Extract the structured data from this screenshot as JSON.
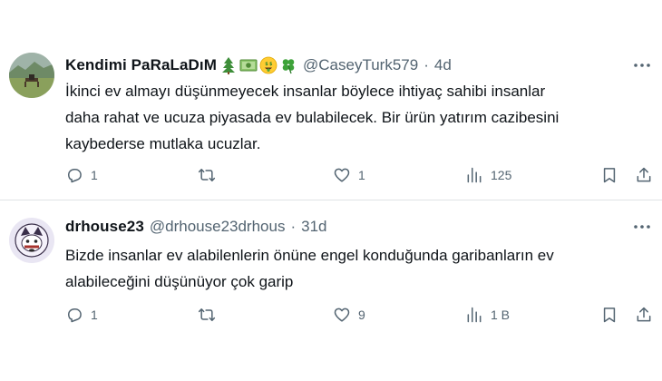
{
  "tweets": [
    {
      "name": "Kendimi PaRaLaDıM",
      "emojis": [
        "tree-emoji",
        "money-emoji",
        "money-face-emoji",
        "clover-emoji"
      ],
      "handle": "@CaseyTurk579",
      "separator": "·",
      "time": "4d",
      "text": "İkinci ev almayı düşünmeyecek insanlar böylece ihtiyaç sahibi insanlar\ndaha rahat ve ucuza piyasada ev bulabilecek. Bir ürün yatırım cazibesini\nkaybederse mutlaka ucuzlar.",
      "replies": "1",
      "retweets": "",
      "likes": "1",
      "views": "125"
    },
    {
      "name": "drhouse23",
      "handle": "@drhouse23drhous",
      "separator": "·",
      "time": "31d",
      "text": "Bizde insanlar ev alabilenlerin önüne engel konduğunda garibanların ev\nalabileceğini düşünüyor çok garip",
      "replies": "1",
      "retweets": "",
      "likes": "9",
      "views": "1 B"
    }
  ],
  "colors": {
    "text_primary": "#0f1419",
    "text_secondary": "#536471",
    "divider": "#dfe3e6"
  }
}
